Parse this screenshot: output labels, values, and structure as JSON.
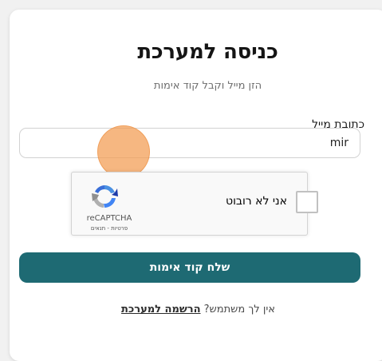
{
  "login": {
    "title": "כניסה למערכת",
    "subtitle": "הזן מייל וקבל קוד אימות",
    "email_label": "כתובת מייל",
    "email_value": "mir"
  },
  "recaptcha": {
    "checkbox_label": "אני לא רובוט",
    "brand": "reCAPTCHA",
    "links": "פרטיות - תנאים"
  },
  "actions": {
    "send_code_label": "שלח קוד אימות"
  },
  "signup": {
    "question": "אין לך משתמש?",
    "link_label": "הרשמה למערכת"
  },
  "colors": {
    "primary": "#1e6a73",
    "touch_indicator": "#f39b50"
  }
}
